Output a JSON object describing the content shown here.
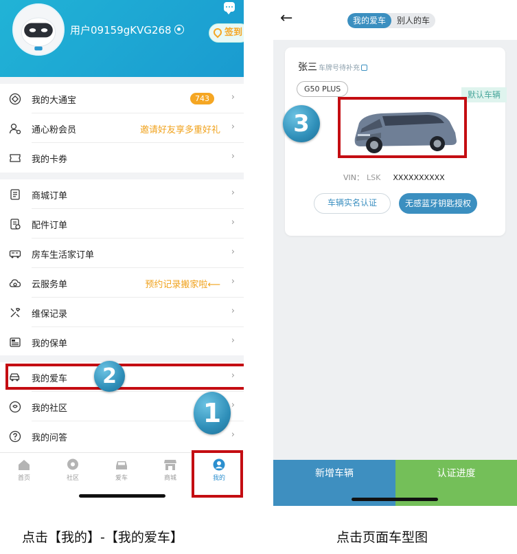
{
  "left_screen": {
    "username": "用户09159gKVG268",
    "checkin_label": "签到",
    "menu_groups": [
      [
        {
          "label": "我的大通宝",
          "icon": "diamond-icon",
          "badge": "743",
          "note": ""
        },
        {
          "label": "通心粉会员",
          "icon": "member-icon",
          "badge": "",
          "note": "邀请好友享多重好礼"
        },
        {
          "label": "我的卡券",
          "icon": "coupon-icon",
          "badge": "",
          "note": ""
        }
      ],
      [
        {
          "label": "商城订单",
          "icon": "order-list-icon",
          "badge": "",
          "note": ""
        },
        {
          "label": "配件订单",
          "icon": "parts-order-icon",
          "badge": "",
          "note": ""
        },
        {
          "label": "房车生活家订单",
          "icon": "rv-icon",
          "badge": "",
          "note": ""
        },
        {
          "label": "云服务单",
          "icon": "cloud-service-icon",
          "badge": "",
          "note": "预约记录搬家啦⟵"
        },
        {
          "label": "维保记录",
          "icon": "wrench-icon",
          "badge": "",
          "note": ""
        },
        {
          "label": "我的保单",
          "icon": "policy-icon",
          "badge": "",
          "note": ""
        }
      ],
      [
        {
          "label": "我的爱车",
          "icon": "car-icon",
          "badge": "",
          "note": ""
        },
        {
          "label": "我的社区",
          "icon": "community-icon",
          "badge": "",
          "note": ""
        },
        {
          "label": "我的问答",
          "icon": "question-icon",
          "badge": "",
          "note": ""
        }
      ]
    ],
    "tabbar": [
      {
        "label": "首页",
        "icon": "home-icon",
        "active": false
      },
      {
        "label": "社区",
        "icon": "chat-bubble-icon",
        "active": false
      },
      {
        "label": "爱车",
        "icon": "car-front-icon",
        "active": false
      },
      {
        "label": "商城",
        "icon": "store-icon",
        "active": false
      },
      {
        "label": "我的",
        "icon": "profile-icon",
        "active": true
      }
    ]
  },
  "right_screen": {
    "segment": [
      "我的爱车",
      "别人的车"
    ],
    "owner_name": "张三",
    "plate_hint": "车牌号待补充",
    "model": "G50 PLUS",
    "default_tag": "默认车辆",
    "vin_label": "VIN：",
    "vin_prefix": "LSK",
    "vin_value": "XXXXXXXXXX",
    "verify_button": "车辆实名认证",
    "bluetooth_button": "无感蓝牙钥匙授权",
    "add_vehicle_button": "新增车辆",
    "verify_progress_button": "认证进度"
  },
  "annotations": {
    "step_badges": [
      "1",
      "2",
      "3"
    ],
    "highlight_color": "#c40d12"
  },
  "captions": {
    "left": "点击【我的】-【我的爱车】",
    "right": "点击页面车型图"
  },
  "colors": {
    "header_blue": "#1fa8d4",
    "primary_blue": "#3b8fc0",
    "orange": "#f5a623",
    "green": "#74bf59"
  }
}
